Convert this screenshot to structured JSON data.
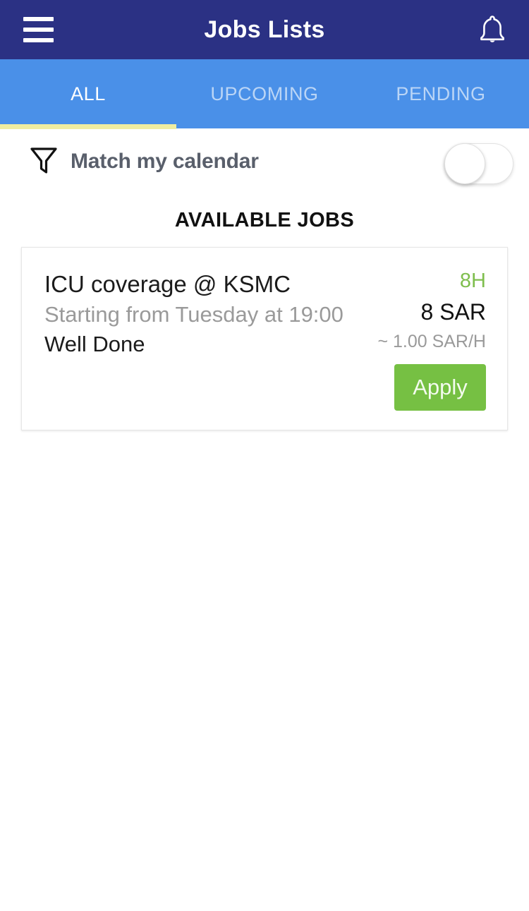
{
  "appbar": {
    "title": "Jobs Lists",
    "menu_icon": "hamburger-menu-icon",
    "notification_icon": "bell-icon",
    "background_color": "#2b3184"
  },
  "tabs": {
    "background_color": "#4a90e8",
    "indicator_color": "#f0eda0",
    "active_index": 0,
    "items": [
      {
        "label": "ALL",
        "active": true
      },
      {
        "label": "UPCOMING",
        "active": false
      },
      {
        "label": "PENDING",
        "active": false
      }
    ]
  },
  "filter": {
    "icon": "funnel-filter-icon",
    "label": "Match my calendar",
    "toggle_state": "off"
  },
  "section": {
    "title": "AVAILABLE JOBS"
  },
  "jobs": [
    {
      "title": "ICU coverage @ KSMC",
      "subtitle": "Starting from Tuesday at 19:00",
      "note": "Well Done",
      "hours": "8H",
      "pay": "8 SAR",
      "rate": "~ 1.00 SAR/H",
      "action_label": "Apply",
      "action_color": "#76c043",
      "hours_color": "#7fbe4e"
    }
  ]
}
